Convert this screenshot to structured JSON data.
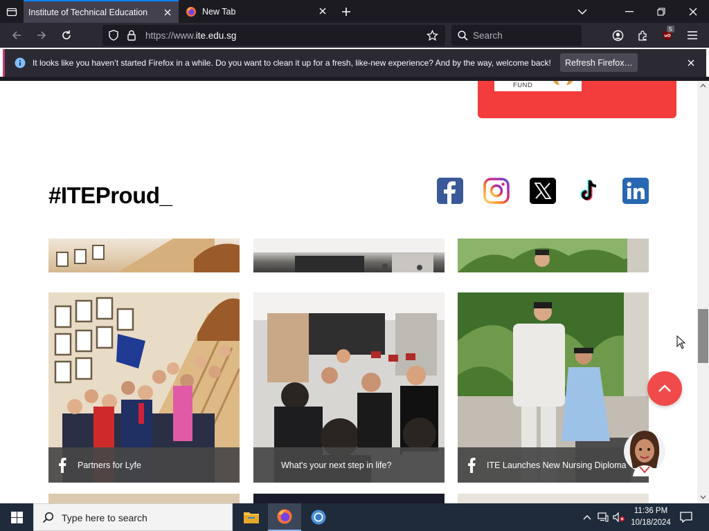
{
  "browser": {
    "tabs": [
      {
        "title": "Institute of Technical Education",
        "active": true
      },
      {
        "title": "New Tab",
        "active": false
      }
    ],
    "url": {
      "scheme": "https://www.",
      "host": "ite.edu.sg"
    },
    "search_placeholder": "Search",
    "extension_badge": "5",
    "notification": {
      "message": "It looks like you haven’t started Firefox in a while. Do you want to clean it up for a fresh, like-new experience? And by the way, welcome back!",
      "button": "Refresh Firefox…"
    }
  },
  "page": {
    "donate_card_text": "FUND",
    "section_title": "#ITEProud_",
    "social_links": [
      "facebook-icon",
      "instagram-icon",
      "x-icon",
      "tiktok-icon",
      "linkedin-icon"
    ],
    "posts_row1": [
      {
        "caption": "Partners for Lyfe",
        "source_icon": "facebook-icon"
      },
      {
        "caption": "What's your next step in life?",
        "source_icon": ""
      },
      {
        "caption": "ITE Launches New Nursing Diploma",
        "source_icon": "facebook-icon"
      }
    ],
    "accent_color": "#f04a4a"
  },
  "taskbar": {
    "search_placeholder": "Type here to search",
    "time": "11:36 PM",
    "date": "10/18/2024",
    "apps": [
      "file-explorer-icon",
      "firefox-icon",
      "chrome-icon"
    ]
  }
}
